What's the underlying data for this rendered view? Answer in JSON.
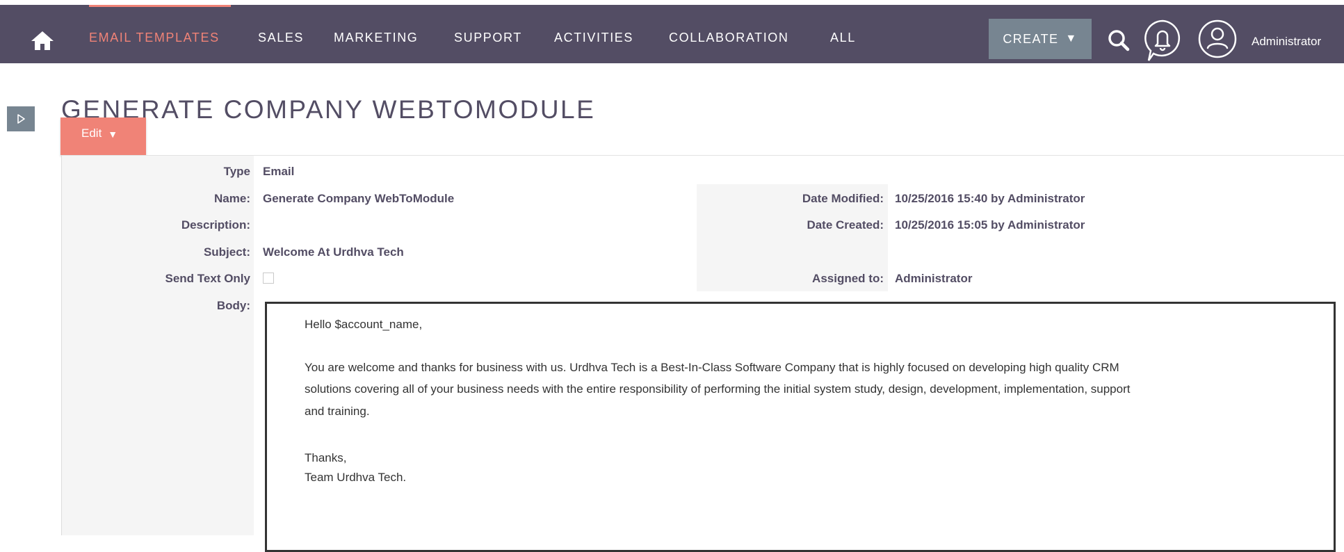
{
  "nav": {
    "items": [
      {
        "label": "EMAIL TEMPLATES",
        "active": true
      },
      {
        "label": "SALES"
      },
      {
        "label": "MARKETING"
      },
      {
        "label": "SUPPORT"
      },
      {
        "label": "ACTIVITIES"
      },
      {
        "label": "COLLABORATION"
      },
      {
        "label": "ALL"
      }
    ],
    "create_label": "CREATE",
    "user_name": "Administrator"
  },
  "page": {
    "title": "GENERATE COMPANY WEBTOMODULE",
    "edit_label": "Edit"
  },
  "detail": {
    "type_label": "Type",
    "type_value": "Email",
    "name_label": "Name:",
    "name_value": "Generate Company WebToModule",
    "description_label": "Description:",
    "subject_label": "Subject:",
    "subject_value": "Welcome At Urdhva Tech",
    "send_text_only_label": "Send Text Only",
    "body_label": "Body:",
    "date_modified_label": "Date Modified:",
    "date_modified_value": "10/25/2016 15:40 by Administrator",
    "date_created_label": "Date Created:",
    "date_created_value": "10/25/2016 15:05 by Administrator",
    "assigned_to_label": "Assigned to:",
    "assigned_to_value": "Administrator"
  },
  "body": {
    "greeting": "Hello $account_name,",
    "paragraph_lines": [
      "You are welcome and thanks for business with us. Urdhva Tech is a Best-In-Class Software Company that is highly focused on developing high quality CRM",
      "solutions covering all of your business needs with the entire responsibility of performing the initial system study, design, development, implementation, support",
      "and training."
    ],
    "closing": "Thanks,",
    "signature": "Team Urdhva Tech."
  },
  "colors": {
    "topbar": "#534d64",
    "accent": "#f08377",
    "create_button": "#778591"
  },
  "icons": [
    "home-icon",
    "search-icon",
    "bell-icon",
    "user-icon",
    "chevron-down-icon",
    "expand-arrow-icon"
  ]
}
